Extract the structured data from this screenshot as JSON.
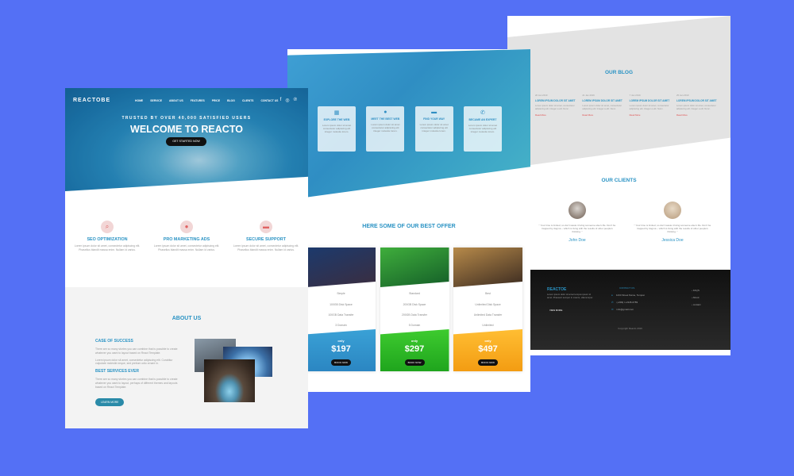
{
  "page1": {
    "logo": "REACTOBE",
    "menu": [
      "HOME",
      "SERVICE",
      "ABOUT US",
      "FEATURES",
      "PRICE",
      "BLOG",
      "CLIENTS",
      "CONTACT US"
    ],
    "social_icons": [
      "facebook-icon",
      "instagram-icon",
      "pinterest-icon"
    ],
    "hero_subtitle": "TRUSTED BY OVER 40,000 SATISFIED USERS",
    "hero_title": "WELCOME TO REACTO",
    "hero_button": "GET STARTED NOW",
    "features": [
      {
        "icon": "search-icon",
        "title": "SEO OPTIMIZATION",
        "desc": "Lorem ipsum dolor sit amet, consectetur adipiscing elit. Phasellus blandit massa enim. Nullam id varius."
      },
      {
        "icon": "user-icon",
        "title": "PRO MARKETING ADS",
        "desc": "Lorem ipsum dolor sit amet, consectetur adipiscing elit. Phasellus blandit massa enim. Nullam id varius."
      },
      {
        "icon": "folder-icon",
        "title": "SECURE SUPPORT",
        "desc": "Lorem ipsum dolor sit amet, consectetur adipiscing elit. Phasellus blandit massa enim. Nullam id varius."
      }
    ],
    "about_title": "ABOUT US",
    "about": {
      "h1": "CASE OF SUCCESS",
      "p1": "There are so many stories you can combine that is possible to create whatever you want to layout based on React Template.",
      "p2": "Lorem ipsum dolor sit amet, consectetur adipiscing elit. Curabitur vulputate molestie neque, sed pretium odio ornare in.",
      "h2": "BEST SERVICES EVER",
      "p3": "There are so many stories you can combine that is possible to create whatever you want to layout, perhaps of different themes and layouts based on React Template.",
      "button": "LEARN MORE"
    }
  },
  "page2": {
    "cards": [
      {
        "icon": "calendar-icon",
        "title": "EXPLORE THE WEB",
        "desc": "Lorem ipsum dolor sit amet consectetur adipiscing elit integer molestie lorem."
      },
      {
        "icon": "person-icon",
        "title": "MEET THE BEST WEB",
        "desc": "Lorem ipsum dolor sit amet consectetur adipiscing elit integer molestie lorem."
      },
      {
        "icon": "folder-icon",
        "title": "FIND YOUR WAY",
        "desc": "Lorem ipsum dolor sit amet consectetur adipiscing elit integer molestie lorem."
      },
      {
        "icon": "phone-icon",
        "title": "BECAME AN EXPERT",
        "desc": "Lorem ipsum dolor sit amet consectetur adipiscing elit integer molestie lorem."
      }
    ],
    "offer_title": "HERE SOME OF OUR BEST OFFER",
    "plans": [
      {
        "name": "Simple",
        "space": "100GB Disk Space",
        "traffic": "100GB Data Transfer",
        "domain": "3 Domain",
        "only": "only",
        "price": "$197",
        "button": "BOOK NOW",
        "top_colors": [
          "#1c3a6d",
          "#3b2d3f"
        ],
        "bottom_colors": [
          "#3aa1d6",
          "#2b86c2"
        ]
      },
      {
        "name": "Standard",
        "space": "200GB Disk Space",
        "traffic": "200GB Data Transfer",
        "domain": "5 Domain",
        "only": "only",
        "price": "$297",
        "button": "BOOK NOW",
        "top_colors": [
          "#3fae3c",
          "#145d28"
        ],
        "bottom_colors": [
          "#3ecb2f",
          "#1fa51d"
        ]
      },
      {
        "name": "Best",
        "space": "Unlimited Disk Space",
        "traffic": "Unlimited Data Transfer",
        "domain": "Unlimited",
        "only": "only",
        "price": "$497",
        "button": "BOOK NOW",
        "top_colors": [
          "#b78a4a",
          "#3a2a20"
        ],
        "bottom_colors": [
          "#ffbe33",
          "#f39c12"
        ]
      }
    ]
  },
  "page3": {
    "blog_title": "OUR BLOG",
    "posts": [
      {
        "date": "20 Jan 2019",
        "title": "LOREM IPSUM DOLOR SIT AMET",
        "excerpt": "Lorem ipsum dolor sit amet, consectetur adipiscing elit. Integer a elit. Nunc.",
        "more": "Read More"
      },
      {
        "date": "21 Jan 2019",
        "title": "LOREM IPSUM DOLOR SIT AMET",
        "excerpt": "Lorem ipsum dolor sit amet, consectetur adipiscing elit. Integer a elit. Nunc.",
        "more": "Read More"
      },
      {
        "date": "7 Jan 2019",
        "title": "LOREM IPSUM DOLOR SIT AMET",
        "excerpt": "Lorem ipsum dolor sit amet, consectetur adipiscing elit. Integer a elit. Nunc.",
        "more": "Read More"
      },
      {
        "date": "25 Jan 2019",
        "title": "LOREM IPSUM DOLOR SIT AMET",
        "excerpt": "Lorem ipsum dolor sit amet, consectetur adipiscing elit. Integer a elit. Nunc.",
        "more": "Read More"
      }
    ],
    "clients_title": "OUR CLIENTS",
    "clients": [
      {
        "quote": "\" Your time is limited, so don't waste it living someone else's life. Don't be trapped by dogma – which is living with the results of other people's thinking. \"",
        "name": "John Doe",
        "avatar_colors": [
          "#d9d4cf",
          "#6b5a4e"
        ]
      },
      {
        "quote": "\" Your time is limited, so don't waste it living someone else's life. Don't be trapped by dogma – which is living with the results of other people's thinking. \"",
        "name": "Jessica Doe",
        "avatar_colors": [
          "#e7d9c6",
          "#b79b7c"
        ]
      }
    ],
    "footer": {
      "logo": "REACTOE",
      "text": "Lorem ipsum dolor sit amet tempus ipsum id amet. Praesent semper in mauris, ullamcorper.",
      "more": "VIEW MORE",
      "contact_heading": "CONTACT US",
      "contacts": [
        "1234 Street Name, Tempat",
        "(+099) 1-2345-6789",
        "info@gmail.com"
      ],
      "links": [
        "FAQS",
        "About",
        "contact"
      ],
      "copyright": "Copyright Reacto 2019"
    }
  }
}
